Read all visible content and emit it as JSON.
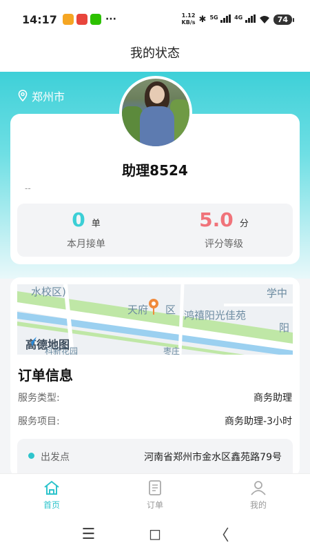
{
  "status_bar": {
    "time": "14:17",
    "net_speed": "1.12",
    "net_speed_unit": "KB/s",
    "net1": "5G",
    "net2": "4G",
    "battery": "74"
  },
  "nav": {
    "title": "我的状态"
  },
  "location": {
    "city": "郑州市"
  },
  "profile": {
    "name": "助理8524",
    "signature": "--"
  },
  "stats": {
    "orders": {
      "value": "0",
      "unit": "单",
      "label": "本月接单"
    },
    "rating": {
      "value": "5.0",
      "unit": "分",
      "label": "评分等级"
    }
  },
  "map": {
    "labels": [
      "水校区)",
      "天府",
      "区",
      "鸿禧阳光佳苑",
      "学中",
      "阳",
      "枣庄",
      "科新花园"
    ],
    "logo": "高德地图"
  },
  "order": {
    "title": "订单信息",
    "service_type_label": "服务类型:",
    "service_type_value": "商务助理",
    "service_item_label": "服务项目:",
    "service_item_value": "商务助理-3小时",
    "depart_label": "出发点",
    "depart_value": "河南省郑州市金水区鑫苑路79号"
  },
  "tabs": [
    {
      "label": "首页",
      "icon": "home-icon",
      "active": true
    },
    {
      "label": "订单",
      "icon": "order-icon",
      "active": false
    },
    {
      "label": "我的",
      "icon": "profile-icon",
      "active": false
    }
  ],
  "colors": {
    "accent": "#2ec4cc",
    "orders_value": "#3ccfd6",
    "rating_value": "#f0737a"
  },
  "system_nav": {
    "menu": "☰",
    "home": "◻",
    "back": "〈"
  }
}
